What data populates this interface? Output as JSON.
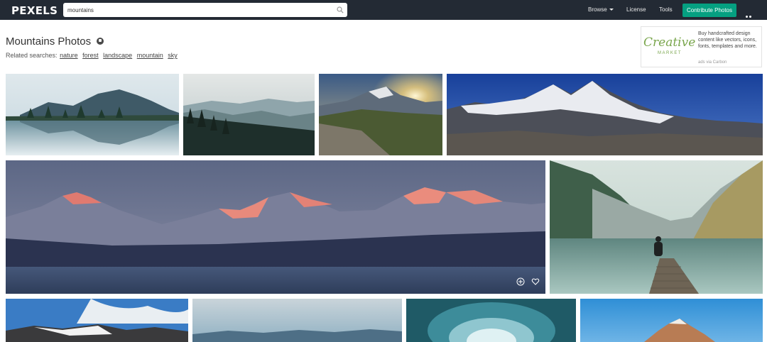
{
  "header": {
    "logo": "PEXELS",
    "search": {
      "value": "mountains",
      "placeholder": "Search for free photos…"
    },
    "nav": {
      "browse": "Browse",
      "license": "License",
      "tools": "Tools"
    },
    "contribute_label": "Contribute Photos"
  },
  "main": {
    "title": "Mountains Photos",
    "related_label": "Related searches:",
    "related": [
      "nature",
      "forest",
      "landscape",
      "mountain",
      "sky"
    ]
  },
  "ad": {
    "logo_main": "Creative",
    "logo_sub": "MARKET",
    "text": "Buy handcrafted design content like vectors, icons, fonts, templates and more.",
    "via": "ads via Carbon"
  },
  "photos": [
    {
      "subject": "mountain lake reflection with pine trees"
    },
    {
      "subject": "misty forest and mountains"
    },
    {
      "subject": "sunset over rocky peaks"
    },
    {
      "subject": "snowy himalayan range"
    },
    {
      "subject": "pink alpenglow peaks over lake"
    },
    {
      "subject": "person sitting on wooden pier at lake"
    },
    {
      "subject": "snow peaks with clouds"
    },
    {
      "subject": "hazy blue mountain layers"
    },
    {
      "subject": "ice cave"
    },
    {
      "subject": "rocky peak at sunrise"
    }
  ],
  "colors": {
    "topbar": "#232a34",
    "accent": "#05a081",
    "ad_brand": "#7aa64d"
  }
}
